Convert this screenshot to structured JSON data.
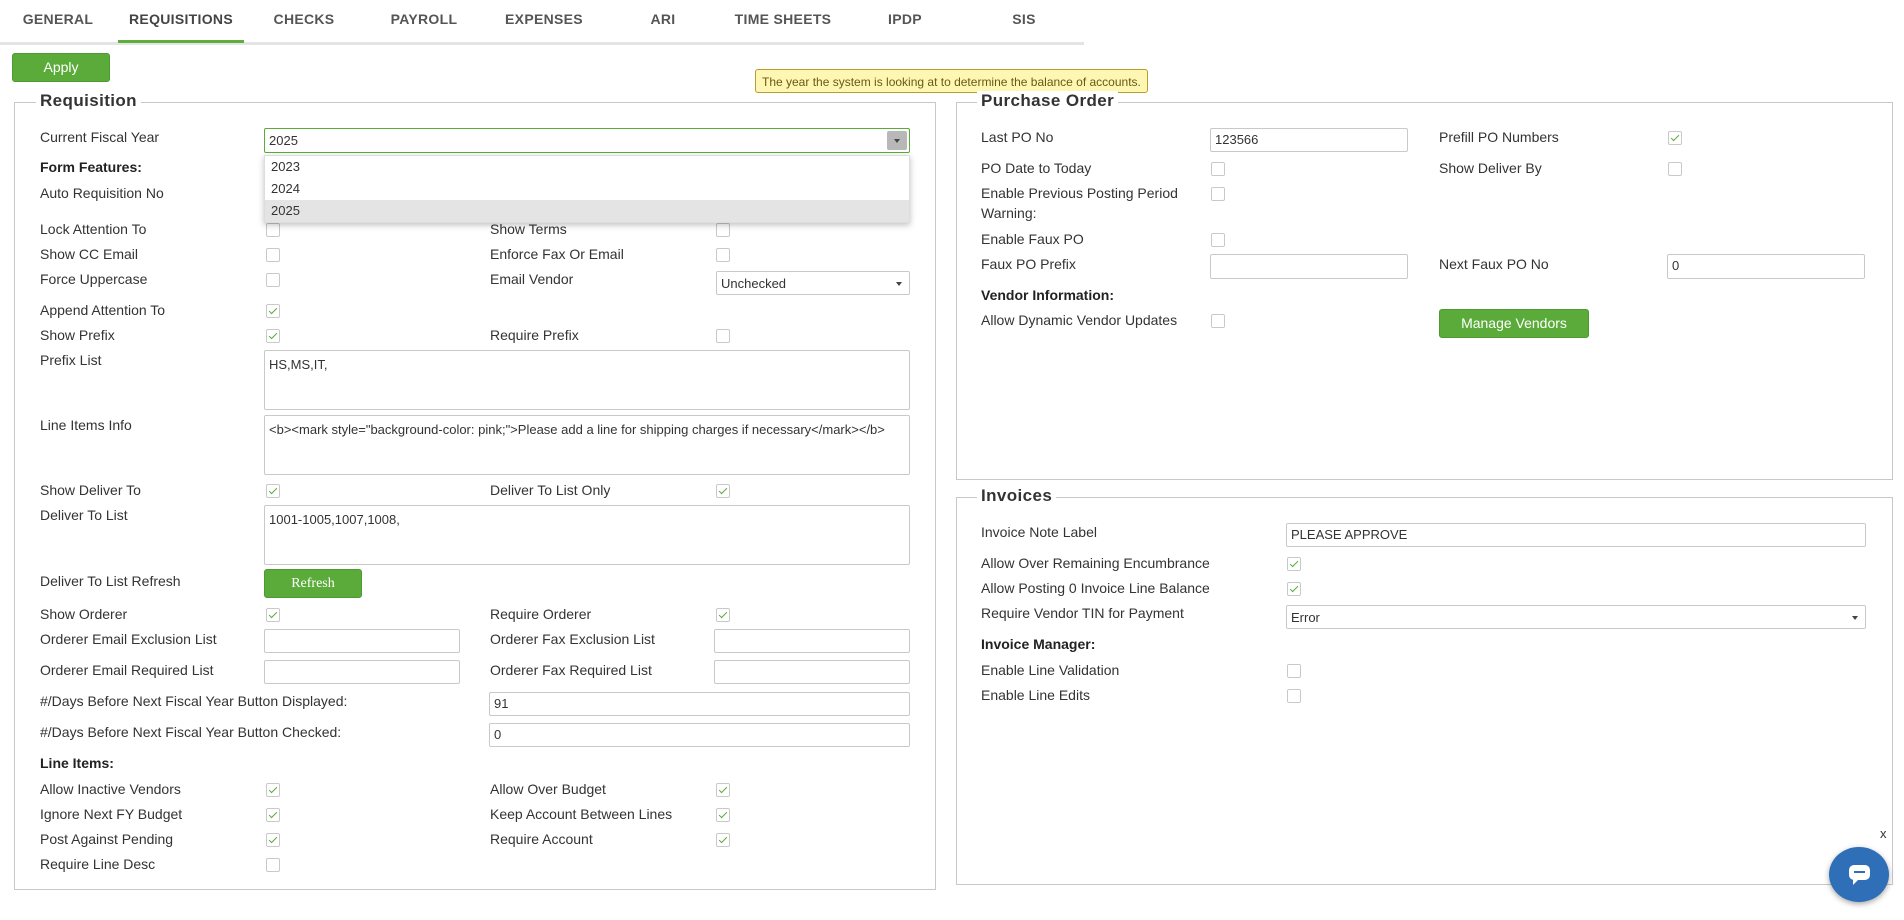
{
  "tabs": [
    "GENERAL",
    "REQUISITIONS",
    "CHECKS",
    "PAYROLL",
    "EXPENSES",
    "ARI",
    "TIME SHEETS",
    "IPDP",
    "SIS"
  ],
  "active_tab": "REQUISITIONS",
  "apply_label": "Apply",
  "tooltip": "The year the system is looking at to determine the balance of accounts.",
  "requisition": {
    "title": "Requisition",
    "current_fiscal_year_label": "Current Fiscal Year",
    "current_fiscal_year_value": "2025",
    "fiscal_year_options": [
      "2023",
      "2024",
      "2025"
    ],
    "form_features_heading": "Form Features:",
    "auto_requisition_no_label": "Auto Requisition No",
    "lock_attention_to_label": "Lock Attention To",
    "show_terms_label": "Show Terms",
    "show_cc_email_label": "Show CC Email",
    "enforce_fax_or_email_label": "Enforce Fax Or Email",
    "force_uppercase_label": "Force Uppercase",
    "email_vendor_label": "Email Vendor",
    "email_vendor_value": "Unchecked",
    "append_attention_to_label": "Append Attention To",
    "show_prefix_label": "Show Prefix",
    "require_prefix_label": "Require Prefix",
    "prefix_list_label": "Prefix List",
    "prefix_list_value": "HS,MS,IT,",
    "line_items_info_label": "Line Items Info",
    "line_items_info_value": "<b><mark style=\"background-color: pink;\">Please add a line for shipping charges if necessary</mark></b>",
    "show_deliver_to_label": "Show Deliver To",
    "deliver_to_list_only_label": "Deliver To List Only",
    "deliver_to_list_label": "Deliver To List",
    "deliver_to_list_value": "1001-1005,1007,1008,",
    "deliver_to_list_refresh_label": "Deliver To List Refresh",
    "refresh_label": "Refresh",
    "show_orderer_label": "Show Orderer",
    "require_orderer_label": "Require Orderer",
    "orderer_email_exclusion_label": "Orderer Email Exclusion List",
    "orderer_fax_exclusion_label": "Orderer Fax Exclusion List",
    "orderer_email_required_label": "Orderer Email Required List",
    "orderer_fax_required_label": "Orderer Fax Required List",
    "days_displayed_label": "#/Days Before Next Fiscal Year Button Displayed:",
    "days_displayed_value": "91",
    "days_checked_label": "#/Days Before Next Fiscal Year Button Checked:",
    "days_checked_value": "0",
    "line_items_heading": "Line Items:",
    "allow_inactive_vendors_label": "Allow Inactive Vendors",
    "allow_over_budget_label": "Allow Over Budget",
    "ignore_next_fy_budget_label": "Ignore Next FY Budget",
    "keep_account_between_lines_label": "Keep Account Between Lines",
    "post_against_pending_label": "Post Against Pending",
    "require_account_label": "Require Account",
    "require_line_desc_label": "Require Line Desc",
    "checkboxes": {
      "lock_attention_to": false,
      "show_terms": false,
      "show_cc_email": false,
      "enforce_fax_or_email": false,
      "force_uppercase": false,
      "append_attention_to": true,
      "show_prefix": true,
      "require_prefix": false,
      "show_deliver_to": true,
      "deliver_to_list_only": true,
      "show_orderer": true,
      "require_orderer": true,
      "allow_inactive_vendors": true,
      "allow_over_budget": true,
      "ignore_next_fy_budget": true,
      "keep_account_between_lines": true,
      "post_against_pending": true,
      "require_account": true,
      "require_line_desc": false
    }
  },
  "purchase_order": {
    "title": "Purchase Order",
    "last_po_no_label": "Last PO No",
    "last_po_no_value": "123566",
    "prefill_po_numbers_label": "Prefill PO Numbers",
    "po_date_to_today_label": "PO Date to Today",
    "show_deliver_by_label": "Show Deliver By",
    "enable_prev_posting_label_1": "Enable Previous Posting Period",
    "enable_prev_posting_label_2": "Warning:",
    "enable_faux_po_label": "Enable Faux PO",
    "faux_po_prefix_label": "Faux PO Prefix",
    "next_faux_po_no_label": "Next Faux PO No",
    "next_faux_po_no_value": "0",
    "vendor_information_heading": "Vendor Information:",
    "allow_dynamic_vendor_updates_label": "Allow Dynamic Vendor Updates",
    "manage_vendors_label": "Manage Vendors",
    "checkboxes": {
      "prefill_po_numbers": true,
      "po_date_to_today": false,
      "show_deliver_by": false,
      "enable_prev_posting": false,
      "enable_faux_po": false,
      "allow_dynamic_vendor_updates": false
    }
  },
  "invoices": {
    "title": "Invoices",
    "invoice_note_label": "Invoice Note Label",
    "invoice_note_value": "PLEASE APPROVE",
    "allow_over_remaining_label": "Allow Over Remaining Encumbrance",
    "allow_posting_zero_label": "Allow Posting 0 Invoice Line Balance",
    "require_vendor_tin_label": "Require Vendor TIN for Payment",
    "require_vendor_tin_value": "Error",
    "invoice_manager_heading": "Invoice Manager:",
    "enable_line_validation_label": "Enable Line Validation",
    "enable_line_edits_label": "Enable Line Edits",
    "checkboxes": {
      "allow_over_remaining": true,
      "allow_posting_zero": true,
      "enable_line_validation": false,
      "enable_line_edits": false
    }
  },
  "chat_close": "x"
}
